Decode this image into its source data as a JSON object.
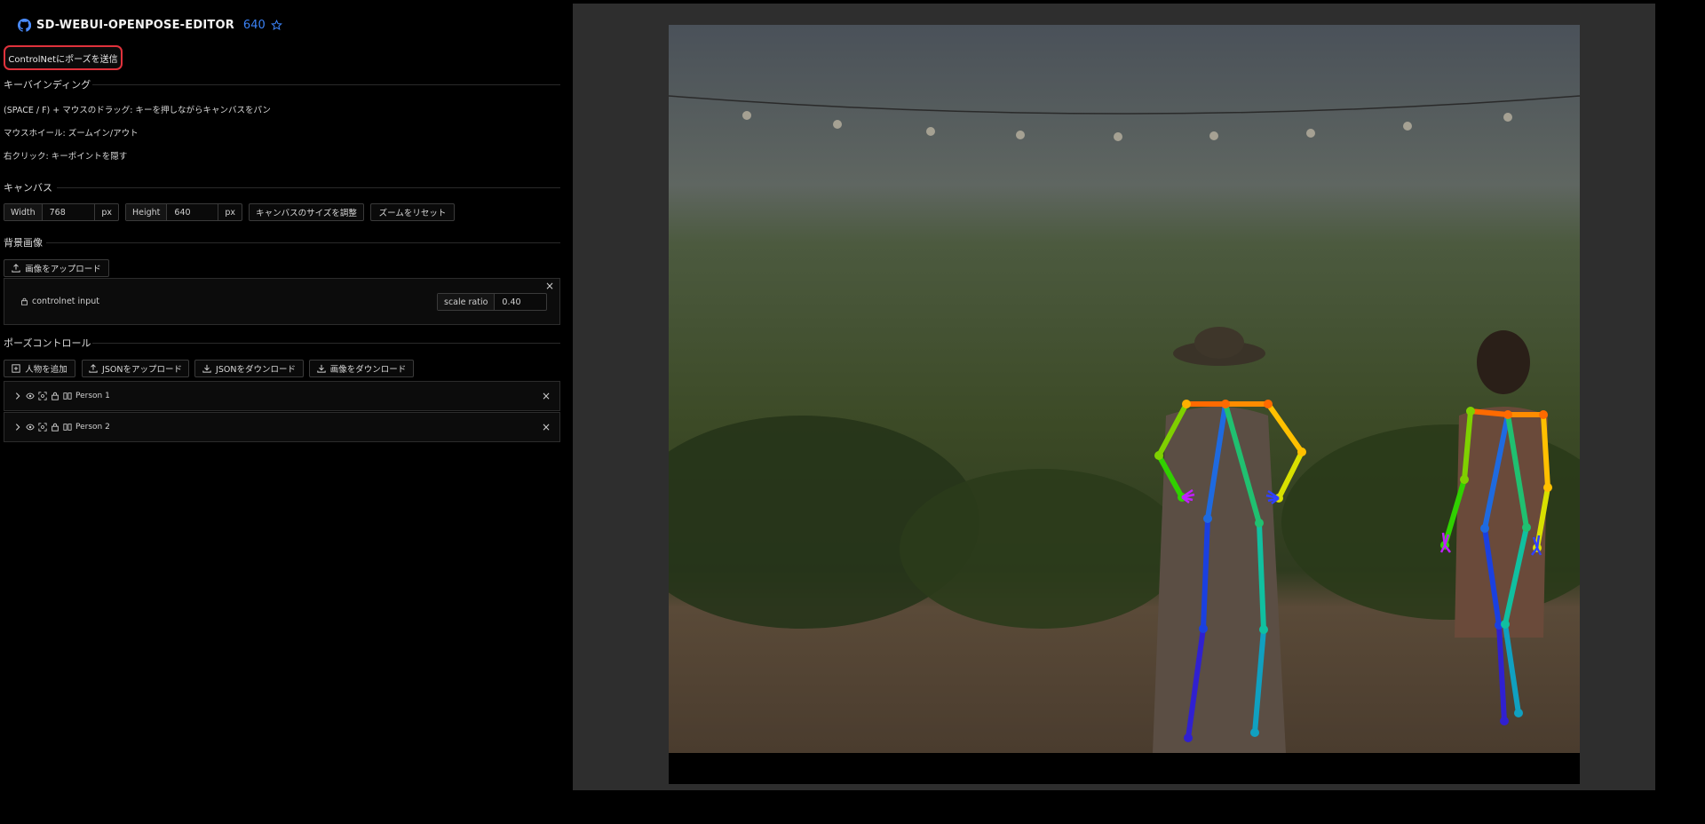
{
  "header": {
    "title": "SD-WEBUI-OPENPOSE-EDITOR",
    "stars": "640",
    "github_icon": "github-icon",
    "star_icon": "star-icon"
  },
  "send_button": {
    "label": "ControlNetにポーズを送信"
  },
  "keybinding": {
    "title": "キーバインディング",
    "lines": [
      "(SPACE / F) + マウスのドラッグ: キーを押しながらキャンバスをパン",
      "マウスホイール: ズームイン/アウト",
      "右クリック: キーポイントを隠す"
    ]
  },
  "canvas_section": {
    "title": "キャンバス",
    "width_label": "Width",
    "width_value": "768",
    "width_unit": "px",
    "height_label": "Height",
    "height_value": "640",
    "height_unit": "px",
    "resize_button": "キャンバスのサイズを調整",
    "reset_zoom_button": "ズームをリセット"
  },
  "background": {
    "title": "背景画像",
    "upload_button": "画像をアップロード",
    "layer_name": "controlnet input",
    "scale_label": "scale ratio",
    "scale_value": "0.40",
    "close": "×"
  },
  "pose_control": {
    "title": "ポーズコントロール",
    "buttons": [
      "人物を追加",
      "JSONをアップロード",
      "JSONをダウンロード",
      "画像をダウンロード"
    ],
    "people": [
      {
        "name": "Person 1",
        "close": "×"
      },
      {
        "name": "Person 2",
        "close": "×"
      }
    ]
  },
  "colors": {
    "accent": "#3b82f6",
    "highlight_border": "#e0323c",
    "panel_bg": "#2e2e2e"
  }
}
